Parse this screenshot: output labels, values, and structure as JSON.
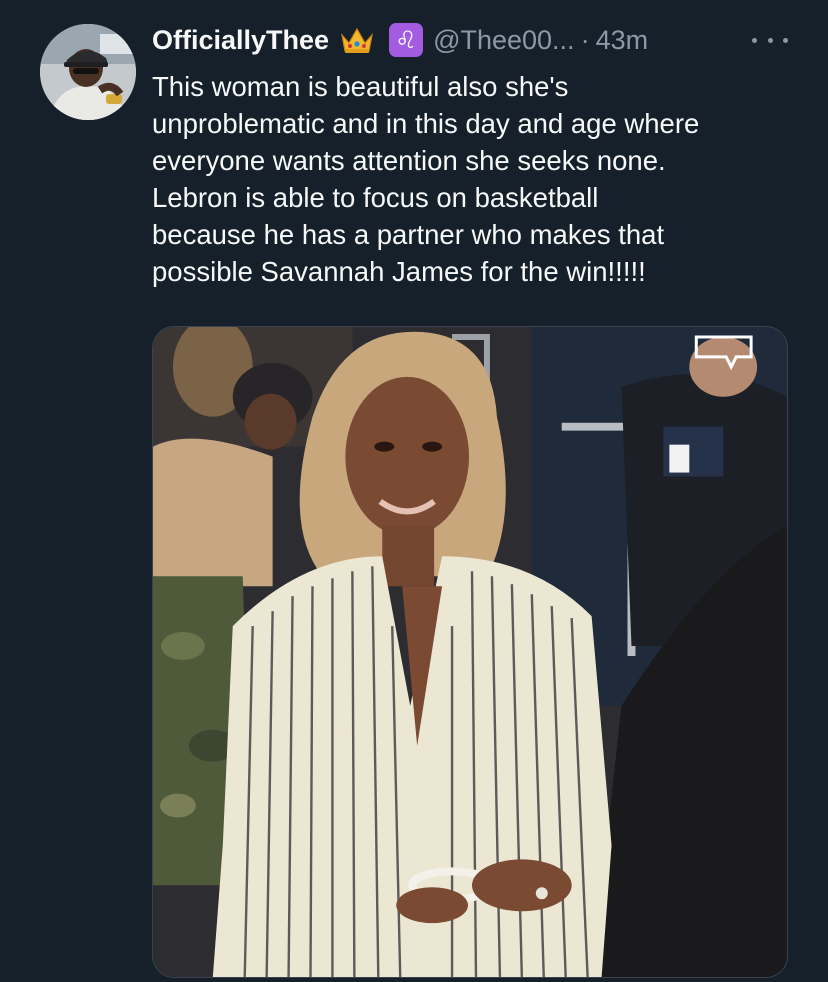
{
  "tweet": {
    "author": {
      "display_name": "OfficiallyThee",
      "badge_emoji_1": "crown-icon",
      "badge_emoji_2": "leo-zodiac-icon",
      "leo_symbol": "♌",
      "handle": "@Thee00...",
      "separator": "·",
      "time": "43m"
    },
    "more_icon": "more-options-icon",
    "text_lines": [
      "This woman is beautiful also she's",
      "unproblematic and in this day and age where",
      "everyone wants attention she seeks none.",
      "Lebron is able to focus on basketball",
      "because he has a partner who makes that",
      "possible Savannah James for the win!!!!!"
    ],
    "media": {
      "type": "photo"
    }
  },
  "colors": {
    "background": "#15202b",
    "primary_text": "#f7f9f9",
    "secondary_text": "#8b98a5",
    "leo_badge": "#a35be0",
    "border": "#38444d"
  }
}
